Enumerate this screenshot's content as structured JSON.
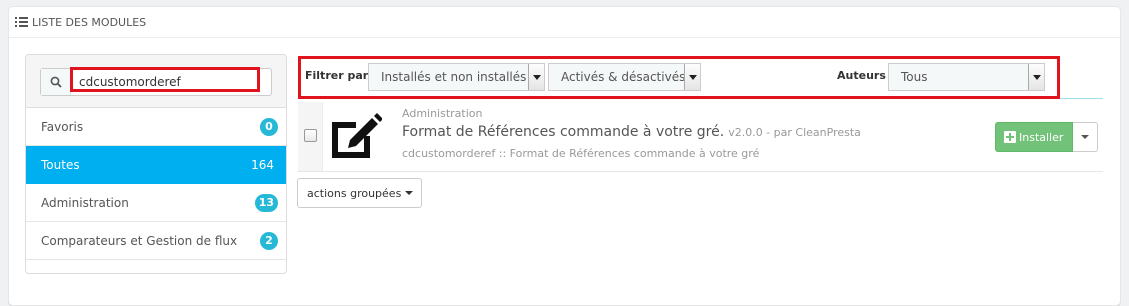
{
  "panel": {
    "title": "LISTE DES MODULES",
    "icon": "list-icon"
  },
  "search": {
    "value": "cdcustomorderef",
    "icon": "search-icon"
  },
  "categories": [
    {
      "label": "Favoris",
      "count": "0",
      "active": false
    },
    {
      "label": "Toutes",
      "count": "164",
      "active": true
    },
    {
      "label": "Administration",
      "count": "13",
      "active": false
    },
    {
      "label": "Comparateurs et Gestion de flux",
      "count": "2",
      "active": false
    }
  ],
  "filters": {
    "filter_label": "Filtrer par",
    "install_filter": "Installés et non installés",
    "status_filter": "Activés & désactivés",
    "authors_label": "Auteurs",
    "authors_filter": "Tous"
  },
  "module": {
    "category": "Administration",
    "name": "Format de Références commande à votre gré.",
    "version": "v2.0.0 - par CleanPresta",
    "description": "cdcustomorderef :: Format de Références commande à votre gré",
    "install_label": "Installer",
    "icon": "edit-icon"
  },
  "bulk_actions": {
    "label": "actions groupées"
  },
  "colors": {
    "active": "#00aff0",
    "badge": "#25b9d7",
    "install": "#72c279",
    "highlight": "#e0141e"
  }
}
